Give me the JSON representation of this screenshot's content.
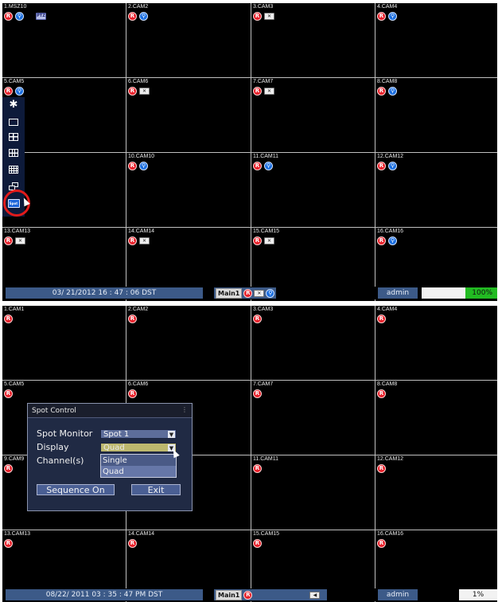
{
  "top_panel": {
    "cameras": [
      {
        "label": "1.MSZ10",
        "icons": [
          "rec",
          "motion",
          "ptz"
        ]
      },
      {
        "label": "2.CAM2",
        "icons": [
          "rec",
          "motion"
        ]
      },
      {
        "label": "3.CAM3",
        "icons": [
          "rec",
          "videoloss"
        ]
      },
      {
        "label": "4.CAM4",
        "icons": [
          "rec",
          "motion"
        ]
      },
      {
        "label": "5.CAM5",
        "icons": [
          "rec",
          "motion"
        ]
      },
      {
        "label": "6.CAM6",
        "icons": [
          "rec",
          "videoloss"
        ]
      },
      {
        "label": "7.CAM7",
        "icons": [
          "rec",
          "videoloss"
        ]
      },
      {
        "label": "8.CAM8",
        "icons": [
          "rec",
          "motion"
        ]
      },
      {
        "label": "",
        "icons": []
      },
      {
        "label": "10.CAM10",
        "icons": [
          "rec",
          "motion"
        ]
      },
      {
        "label": "11.CAM11",
        "icons": [
          "rec",
          "motion"
        ]
      },
      {
        "label": "12.CAM12",
        "icons": [
          "rec",
          "motion"
        ]
      },
      {
        "label": "13.CAM13",
        "icons": [
          "rec",
          "videoloss"
        ]
      },
      {
        "label": "14.CAM14",
        "icons": [
          "rec",
          "videoloss"
        ]
      },
      {
        "label": "15.CAM15",
        "icons": [
          "rec",
          "videoloss"
        ]
      },
      {
        "label": "16.CAM16",
        "icons": [
          "rec",
          "motion"
        ]
      }
    ],
    "status": {
      "datetime": "03/ 21/2012 16 : 47 : 06 DST",
      "main_label": "Main1",
      "user": "admin",
      "disk_percent": "100%",
      "disk_fill": 1.0
    },
    "toolbar": {
      "items": [
        "settings-icon",
        "single-view-icon",
        "quad-view-icon",
        "nine-view-icon",
        "sixteen-view-icon",
        "sequence-icon",
        "spot-monitor-icon"
      ],
      "spot_text": "Spot"
    }
  },
  "bottom_panel": {
    "cameras": [
      {
        "label": "1.CAM1"
      },
      {
        "label": "2.CAM2"
      },
      {
        "label": "3.CAM3"
      },
      {
        "label": "4.CAM4"
      },
      {
        "label": "5.CAM5"
      },
      {
        "label": "6.CAM6"
      },
      {
        "label": "7.CAM7"
      },
      {
        "label": "8.CAM8"
      },
      {
        "label": "9.CAM9"
      },
      {
        "label": ""
      },
      {
        "label": "11.CAM11"
      },
      {
        "label": "12.CAM12"
      },
      {
        "label": "13.CAM13"
      },
      {
        "label": "14.CAM14"
      },
      {
        "label": "15.CAM15"
      },
      {
        "label": "16.CAM16"
      }
    ],
    "status": {
      "datetime": "08/22/ 2011 03 : 35 : 47 PM DST",
      "main_label": "Main1",
      "user": "admin",
      "disk_percent": "1%",
      "disk_fill": 0.01
    },
    "dialog": {
      "title": "Spot Control",
      "spot_monitor_label": "Spot Monitor",
      "spot_monitor_value": "Spot 1",
      "display_label": "Display",
      "display_value": "Quad",
      "channels_label": "Channel(s)",
      "dropdown_options": [
        "Single",
        "Quad"
      ],
      "sequence_button": "Sequence On",
      "exit_button": "Exit"
    }
  },
  "icon_text": {
    "rec": "R",
    "videoloss": "✕",
    "motion": "⚲",
    "ptz": "PTZ"
  }
}
